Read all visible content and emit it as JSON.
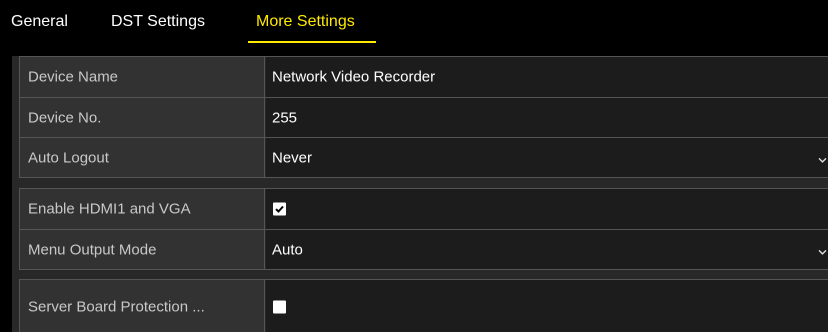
{
  "tabs": [
    {
      "label": "General",
      "active": false
    },
    {
      "label": "DST Settings",
      "active": false
    },
    {
      "label": "More Settings",
      "active": true
    }
  ],
  "settings": {
    "device_name": {
      "label": "Device Name",
      "value": "Network Video Recorder"
    },
    "device_no": {
      "label": "Device No.",
      "value": "255"
    },
    "auto_logout": {
      "label": "Auto Logout",
      "value": "Never"
    },
    "enable_hdmi_vga": {
      "label": "Enable HDMI1 and VGA",
      "checked": true
    },
    "menu_output_mode": {
      "label": "Menu Output Mode",
      "value": "Auto"
    },
    "server_board_protection": {
      "label": "Server Board Protection ...",
      "checked": false
    }
  },
  "colors": {
    "active_tab": "#ffea00",
    "background": "#000000",
    "label_bg": "#323232",
    "value_bg": "#1c1c1c"
  },
  "icons": {
    "dropdown": "chevron-down-icon",
    "check": "check-icon"
  }
}
